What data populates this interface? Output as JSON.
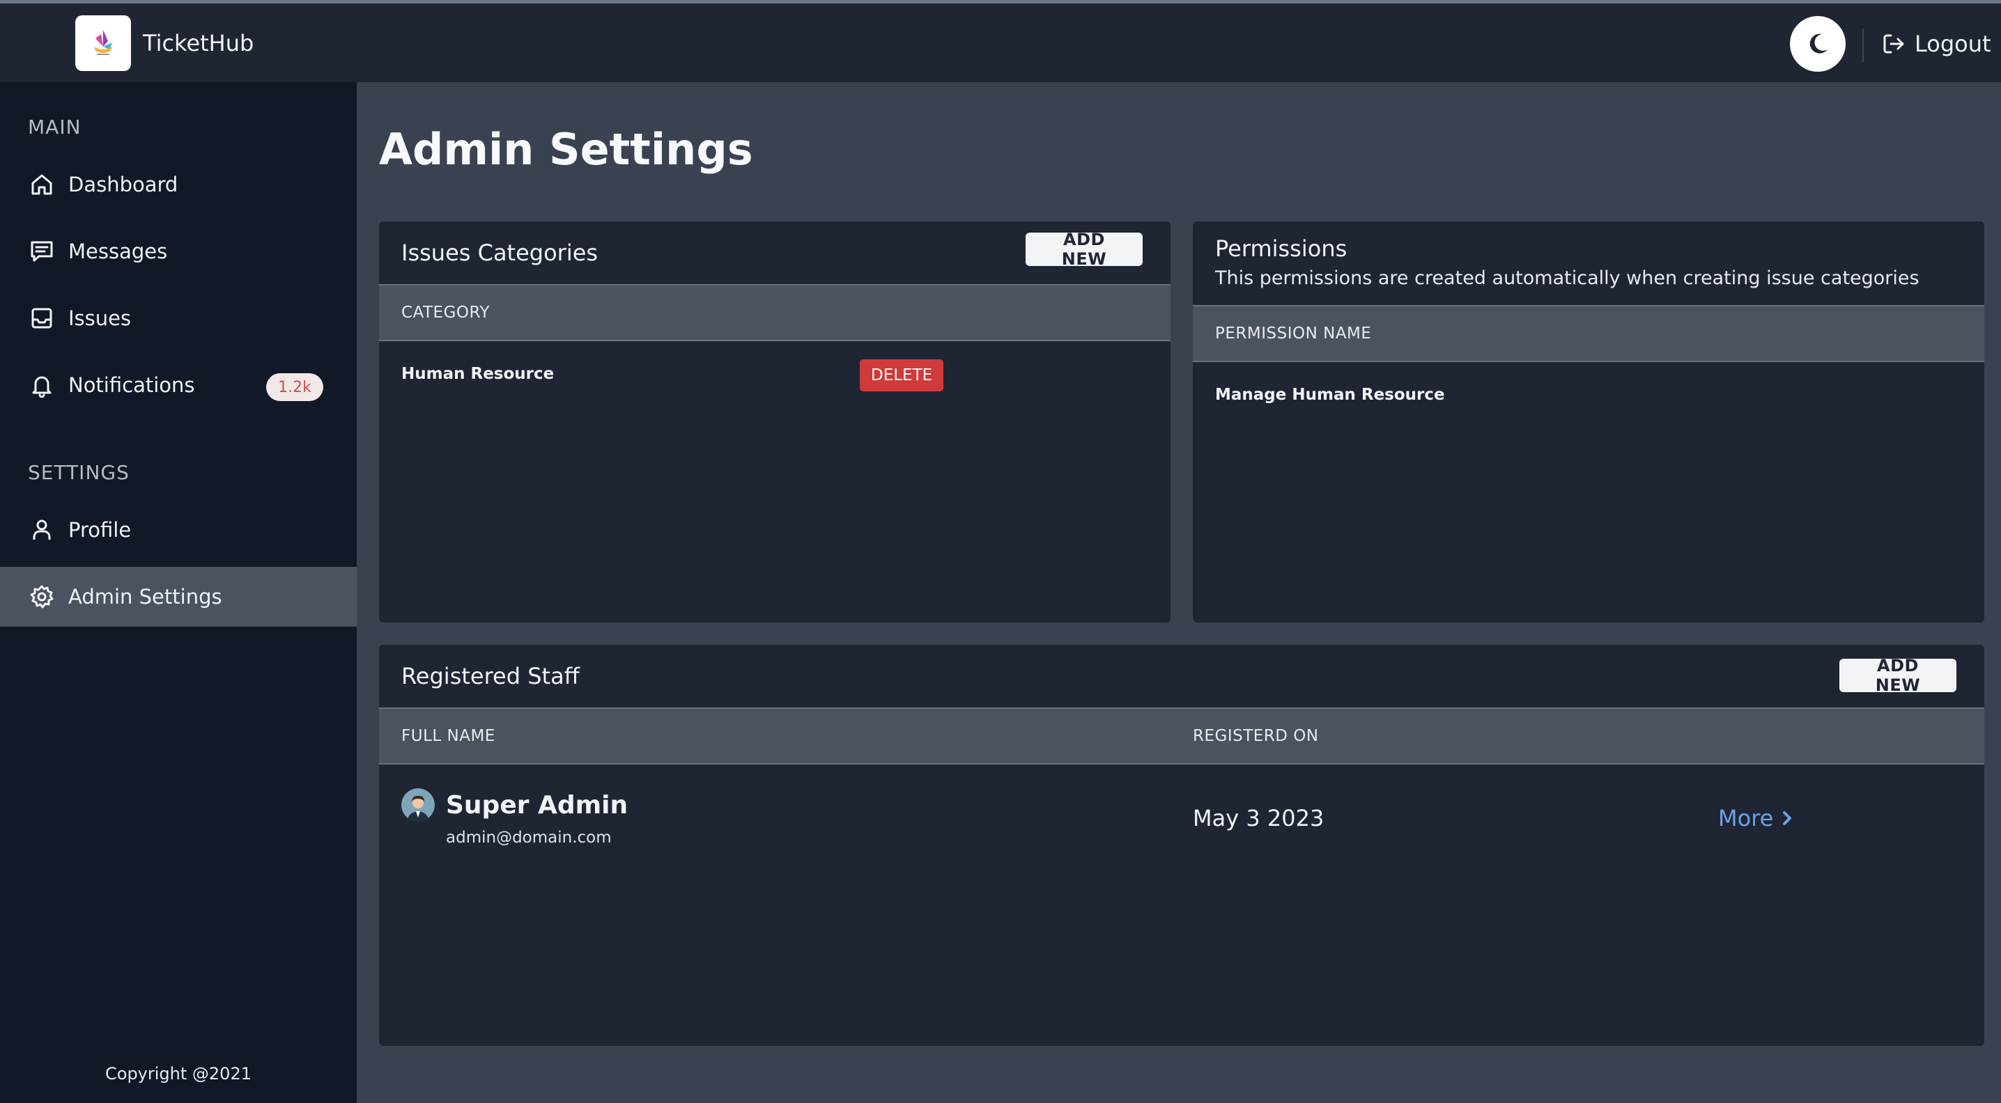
{
  "app": {
    "title": "TicketHub"
  },
  "topbar": {
    "logout_label": "Logout",
    "theme_icon": "moon-icon"
  },
  "sidebar": {
    "main_label": "MAIN",
    "settings_label": "SETTINGS",
    "items": [
      {
        "label": "Dashboard",
        "icon": "home-icon"
      },
      {
        "label": "Messages",
        "icon": "message-icon"
      },
      {
        "label": "Issues",
        "icon": "inbox-icon"
      },
      {
        "label": "Notifications",
        "icon": "bell-icon",
        "badge": "1.2k"
      },
      {
        "label": "Profile",
        "icon": "user-icon"
      },
      {
        "label": "Admin Settings",
        "icon": "gear-icon",
        "active": true
      }
    ],
    "copyright": "Copyright @2021"
  },
  "page": {
    "title": "Admin Settings"
  },
  "categories": {
    "title": "Issues Categories",
    "add_label": "ADD NEW",
    "column": "CATEGORY",
    "rows": [
      {
        "name": "Human Resource",
        "delete_label": "DELETE"
      }
    ]
  },
  "permissions": {
    "title": "Permissions",
    "subtitle": "This permissions are created automatically when creating issue categories",
    "column": "PERMISSION NAME",
    "rows": [
      {
        "name": "Manage Human Resource"
      }
    ]
  },
  "staff": {
    "title": "Registered Staff",
    "add_label": "ADD NEW",
    "columns": {
      "name": "FULL NAME",
      "registered": "REGISTERD ON"
    },
    "rows": [
      {
        "name": "Super Admin",
        "email": "admin@domain.com",
        "registered": "May 3 2023",
        "more_label": "More"
      }
    ]
  },
  "colors": {
    "sidebar_bg": "#111827",
    "card_bg": "#1f2533",
    "page_bg": "#3a4252",
    "delete": "#d03a3a",
    "link": "#6aa2e8"
  }
}
